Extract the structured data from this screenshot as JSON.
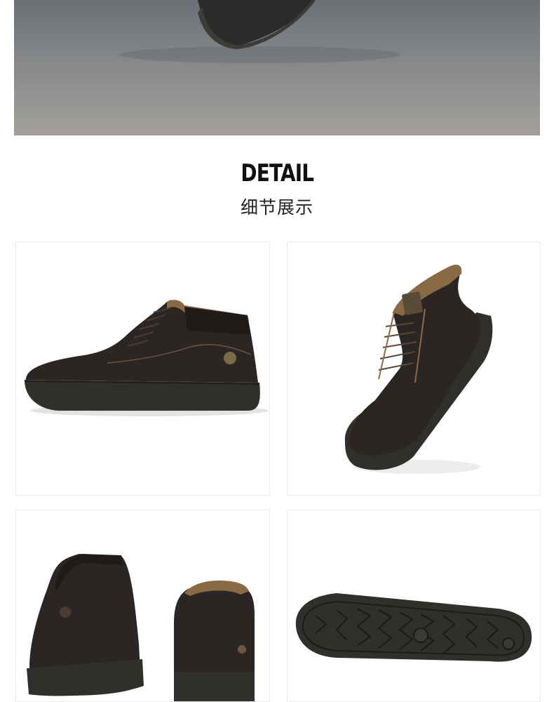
{
  "section": {
    "title_en": "DETAIL",
    "title_cn": "细节展示"
  },
  "images": [
    {
      "name": "side-view",
      "icon": "shoe-side-icon"
    },
    {
      "name": "angled-view",
      "icon": "shoe-angle-icon"
    },
    {
      "name": "back-view",
      "icon": "shoe-back-icon"
    },
    {
      "name": "sole-view",
      "icon": "shoe-sole-icon"
    }
  ],
  "colors": {
    "leather": "#2b2624",
    "sole": "#2f2f2c",
    "accent_stitch": "#8a6a45"
  }
}
